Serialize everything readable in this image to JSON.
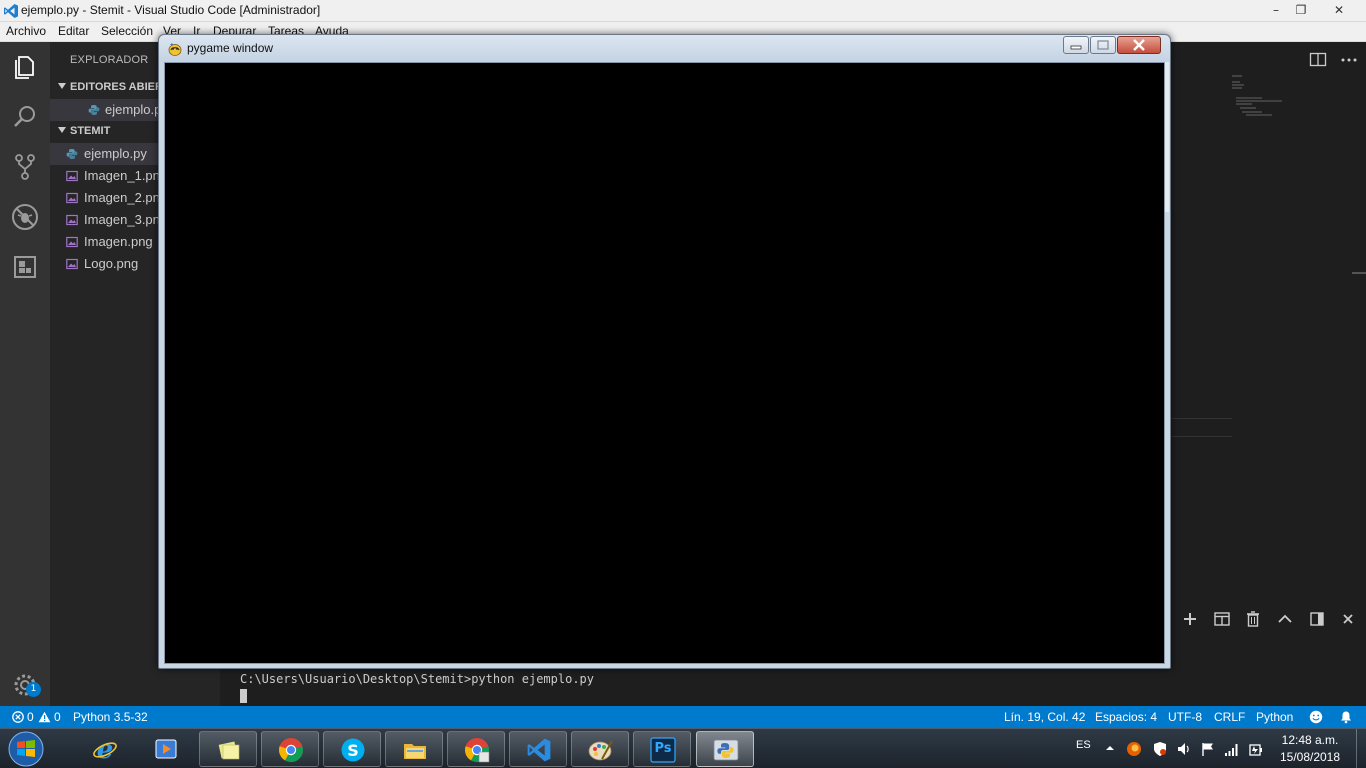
{
  "window": {
    "title": "ejemplo.py - Stemit - Visual Studio Code [Administrador]",
    "minimize": "–",
    "maximize": "❐",
    "close": "✕"
  },
  "menu": {
    "items": [
      "Archivo",
      "Editar",
      "Selección",
      "Ver",
      "Ir",
      "Depurar",
      "Tareas",
      "Ayuda"
    ]
  },
  "activity_bar": {
    "icons": [
      "files-icon",
      "search-icon",
      "source-control-icon",
      "debug-icon",
      "extensions-icon",
      "gear-icon"
    ],
    "badge": "1"
  },
  "sidebar": {
    "heading": "EXPLORADOR",
    "open_editors_label": "EDITORES ABIERTOS",
    "open_editors": [
      {
        "name": "ejemplo.py",
        "icon": "python-file-icon"
      }
    ],
    "project_label": "STEMIT",
    "files": [
      {
        "name": "ejemplo.py",
        "icon": "python-file-icon"
      },
      {
        "name": "Imagen_1.png",
        "icon": "image-file-icon"
      },
      {
        "name": "Imagen_2.png",
        "icon": "image-file-icon"
      },
      {
        "name": "Imagen_3.png",
        "icon": "image-file-icon"
      },
      {
        "name": "Imagen.png",
        "icon": "image-file-icon"
      },
      {
        "name": "Logo.png",
        "icon": "image-file-icon"
      }
    ]
  },
  "pygame_window": {
    "title": "pygame window"
  },
  "terminal": {
    "command_line": "C:\\Users\\Usuario\\Desktop\\Stemit>python ejemplo.py"
  },
  "panel_toolbar": {
    "icons": [
      "plus-icon",
      "split-terminal-icon",
      "trash-icon",
      "chevron-up-icon",
      "maximize-panel-icon",
      "close-icon"
    ]
  },
  "status_bar": {
    "errors": "0",
    "warnings": "0",
    "interpreter": "Python 3.5-32",
    "position": "Lín. 19, Col. 42",
    "spaces": "Espacios: 4",
    "encoding": "UTF-8",
    "eol": "CRLF",
    "language": "Python",
    "colors": {
      "background": "#007acc"
    }
  },
  "taskbar": {
    "apps": [
      "internet-explorer-icon",
      "media-player-icon",
      "file-folders-icon",
      "chrome-icon",
      "skype-icon",
      "file-explorer-icon",
      "chrome-canary-icon",
      "vscode-icon",
      "paint-icon",
      "photoshop-icon",
      "python-icon"
    ],
    "photoshop_label": "Ps",
    "language": "ES",
    "time": "12:48 a.m.",
    "date": "15/08/2018"
  }
}
